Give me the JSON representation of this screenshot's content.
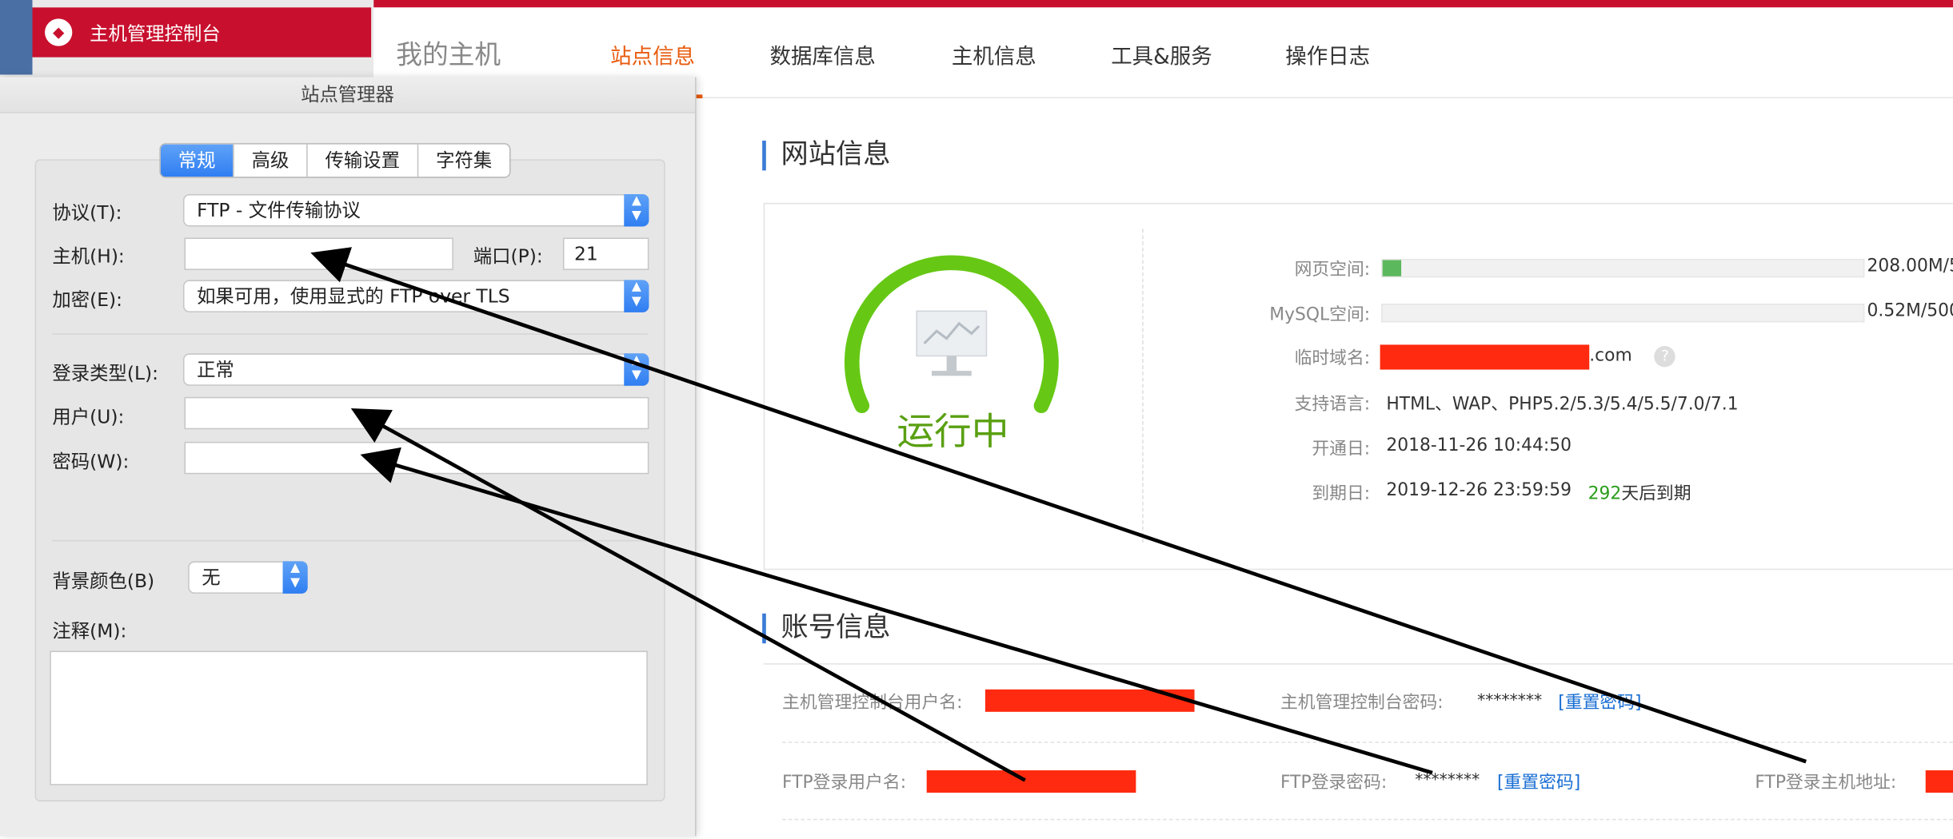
{
  "console": {
    "brand": "主机管理控制台",
    "home_label": "我的主机",
    "tabs": [
      "站点信息",
      "数据库信息",
      "主机信息",
      "工具&服务",
      "操作日志"
    ],
    "active_tab_index": 0,
    "site_section_title": "网站信息",
    "status_text": "运行中",
    "web_space": {
      "label": "网页空间:",
      "value": "208.00M/5",
      "fill_fraction": 0.04
    },
    "mysql_space": {
      "label": "MySQL空间:",
      "value": "0.52M/500",
      "fill_fraction": 0.0
    },
    "temp_domain": {
      "label": "临时域名:",
      "suffix": ".com"
    },
    "languages": {
      "label": "支持语言:",
      "value": "HTML、WAP、PHP5.2/5.3/5.4/5.5/7.0/7.1"
    },
    "open_date": {
      "label": "开通日:",
      "value": "2018-11-26 10:44:50"
    },
    "expire_date": {
      "label": "到期日:",
      "value": "2019-12-26 23:59:59",
      "days": "292",
      "days_suffix": "天后到期"
    },
    "account_section_title": "账号信息",
    "account": {
      "console_user_label": "主机管理控制台用户名:",
      "console_pwd_label": "主机管理控制台密码:",
      "console_pwd_value": "********",
      "reset_pwd": "[重置密码]",
      "ftp_user_label": "FTP登录用户名:",
      "ftp_pwd_label": "FTP登录密码:",
      "ftp_pwd_value": "********",
      "ftp_reset_pwd": "[重置密码]",
      "ftp_host_label": "FTP登录主机地址:"
    },
    "accent_color": "#e85a0c",
    "brand_color": "#c8102e",
    "status_color": "#5aa012"
  },
  "dialog": {
    "title": "站点管理器",
    "tabs": [
      "常规",
      "高级",
      "传输设置",
      "字符集"
    ],
    "selected_tab": "常规",
    "protocol": {
      "label": "协议(T):",
      "value": "FTP - 文件传输协议"
    },
    "host": {
      "label": "主机(H):",
      "value": ""
    },
    "port": {
      "label": "端口(P):",
      "value": "21"
    },
    "encryption": {
      "label": "加密(E):",
      "value": "如果可用，使用显式的 FTP over TLS"
    },
    "login_type": {
      "label": "登录类型(L):",
      "value": "正常"
    },
    "user": {
      "label": "用户(U):",
      "value": ""
    },
    "password": {
      "label": "密码(W):",
      "value": ""
    },
    "bg_color": {
      "label": "背景颜色(B)",
      "value": "无"
    },
    "comments": {
      "label": "注释(M):",
      "value": ""
    }
  }
}
